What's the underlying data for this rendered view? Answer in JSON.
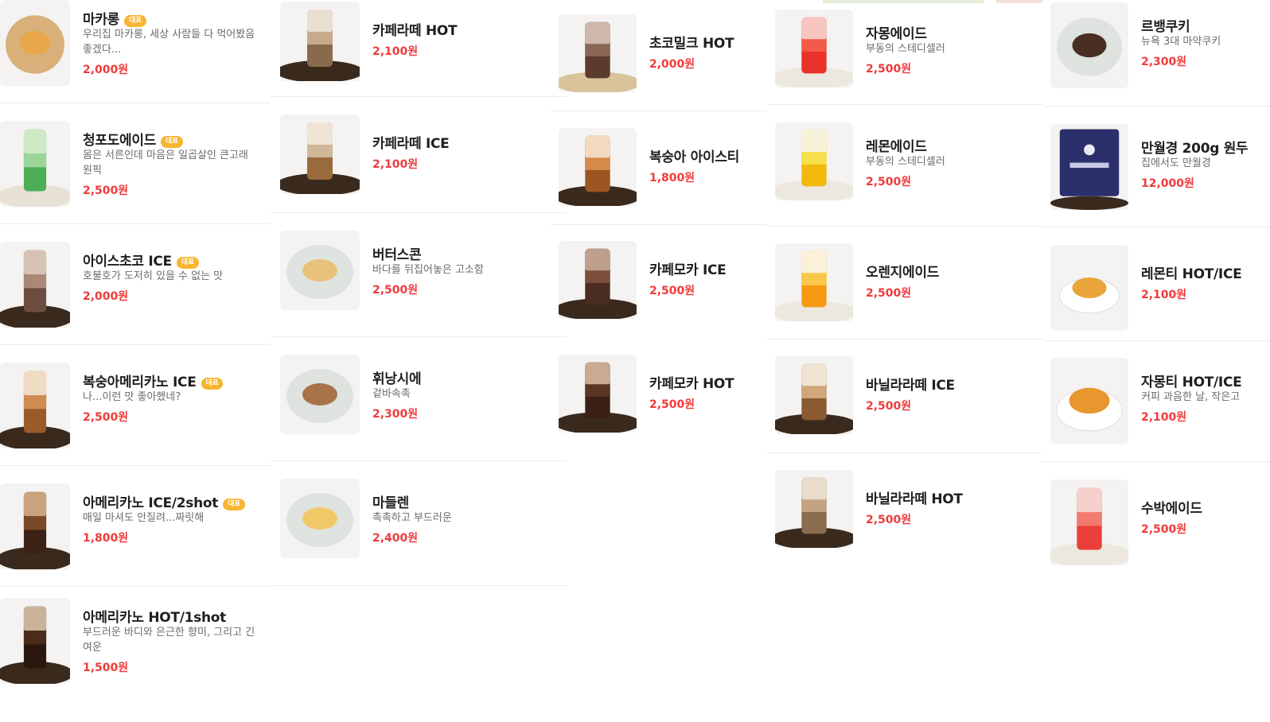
{
  "badge_label": "대표",
  "colors": {
    "price": "#ef3b3b",
    "badge": "#f7b531"
  },
  "columns": [
    [
      {
        "name": "마카롱",
        "badge": true,
        "desc": "우리집 마카롱, 세상 사람들 다 먹어봤음 좋겠다...",
        "price": "2,000원",
        "image": "macaron-on-wood-board"
      },
      {
        "name": "청포도에이드",
        "badge": true,
        "desc": "몸은 서른인데 마음은 일곱살인 큰고래 원픽",
        "price": "2,500원",
        "image": "green-grape-ade-glass"
      },
      {
        "name": "아이스초코 ICE",
        "badge": true,
        "desc": "호불호가 도저히 있을 수 없는 맛",
        "price": "2,000원",
        "image": "iced-chocolate-glass"
      },
      {
        "name": "복숭아메리카노 ICE",
        "badge": true,
        "desc": "나...이런 맛 좋아했네?",
        "price": "2,500원",
        "image": "peach-americano-glass"
      },
      {
        "name": "아메리카노 ICE/2shot",
        "badge": true,
        "desc": "매일 마셔도 안질려...짜릿해",
        "price": "1,800원",
        "image": "iced-americano-glass"
      },
      {
        "name": "아메리카노 HOT/1shot",
        "badge": false,
        "desc": "부드러운 바디와 은근한 향미, 그리고 긴 여운",
        "price": "1,500원",
        "image": "hot-americano-glass"
      }
    ],
    [
      {
        "name": "카페라떼 HOT",
        "badge": false,
        "desc": "",
        "price": "2,100원",
        "image": "hot-latte-glass"
      },
      {
        "name": "카페라떼 ICE",
        "badge": false,
        "desc": "",
        "price": "2,100원",
        "image": "iced-latte-glass"
      },
      {
        "name": "버터스콘",
        "badge": false,
        "desc": "바다를 뒤집어놓은 고소함",
        "price": "2,500원",
        "image": "butter-scone-plate"
      },
      {
        "name": "휘낭시에",
        "badge": false,
        "desc": "겉바속촉",
        "price": "2,300원",
        "image": "financier-plate"
      },
      {
        "name": "마들렌",
        "badge": false,
        "desc": "촉촉하고 부드러운",
        "price": "2,400원",
        "image": "madeleine-plate"
      }
    ],
    [
      {
        "name": "초코밀크 HOT",
        "badge": false,
        "desc": "",
        "price": "2,000원",
        "image": "hot-choco-milk-glass"
      },
      {
        "name": "복숭아 아이스티",
        "badge": false,
        "desc": "",
        "price": "1,800원",
        "image": "peach-iced-tea-glass"
      },
      {
        "name": "카페모카 ICE",
        "badge": false,
        "desc": "",
        "price": "2,500원",
        "image": "iced-cafe-mocha-glass"
      },
      {
        "name": "카페모카 HOT",
        "badge": false,
        "desc": "",
        "price": "2,500원",
        "image": "hot-cafe-mocha-glass"
      }
    ],
    [
      {
        "name": "자몽에이드",
        "badge": false,
        "desc": "부동의 스테디셀러",
        "price": "2,500원",
        "image": "grapefruit-ade-glass"
      },
      {
        "name": "레몬에이드",
        "badge": false,
        "desc": "부동의 스테디셀러",
        "price": "2,500원",
        "image": "lemon-ade-glass"
      },
      {
        "name": "오렌지에이드",
        "badge": false,
        "desc": "",
        "price": "2,500원",
        "image": "orange-ade-glass"
      },
      {
        "name": "바닐라라떼 ICE",
        "badge": false,
        "desc": "",
        "price": "2,500원",
        "image": "iced-vanilla-latte-glass"
      },
      {
        "name": "바닐라라떼 HOT",
        "badge": false,
        "desc": "",
        "price": "2,500원",
        "image": "hot-vanilla-latte-glass"
      }
    ],
    [
      {
        "name": "르뱅쿠키",
        "badge": false,
        "desc": "뉴욕 3대 마약쿠키",
        "price": "2,300원",
        "image": "levain-cookie-plate"
      },
      {
        "name": "만월경 200g 원두",
        "badge": false,
        "desc": "집에서도 만월경",
        "price": "12,000원",
        "image": "coffee-bean-bag"
      },
      {
        "name": "레몬티 HOT/ICE",
        "badge": false,
        "desc": "",
        "price": "2,100원",
        "image": "lemon-tea-cup"
      },
      {
        "name": "자몽티 HOT/ICE",
        "badge": false,
        "desc": "커피 과음한 날, 작은고",
        "price": "2,100원",
        "image": "grapefruit-tea-cup"
      },
      {
        "name": "수박에이드",
        "badge": false,
        "desc": "",
        "price": "2,500원",
        "image": "watermelon-ade-glass"
      }
    ]
  ]
}
